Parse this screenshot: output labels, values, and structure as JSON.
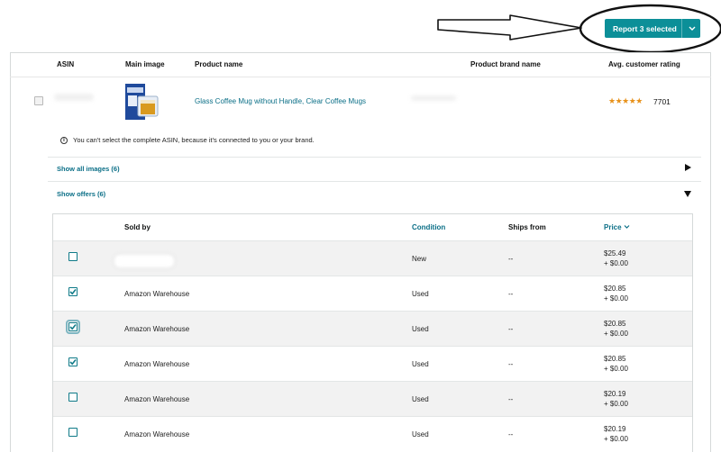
{
  "top_action": {
    "report_label": "Report 3 selected"
  },
  "columns": {
    "asin": "ASIN",
    "main_image": "Main image",
    "product_name": "Product name",
    "brand_name": "Product brand name",
    "rating": "Avg. customer rating"
  },
  "product": {
    "name": "Glass Coffee Mug without Handle, Clear Coffee Mugs",
    "stars": "★★★★★",
    "rating_count": "7701",
    "rating_value": 4.5
  },
  "info": {
    "text": "You can't select the complete ASIN, because it's connected to you or your brand.",
    "icon": "info-icon"
  },
  "sections": {
    "show_images": "Show all images (6)",
    "show_offers": "Show offers (6)"
  },
  "offers_table": {
    "headers": {
      "sold_by": "Sold by",
      "condition": "Condition",
      "ships_from": "Ships from",
      "price": "Price"
    },
    "rows": [
      {
        "seller": "",
        "condition": "New",
        "ships_from": "--",
        "price": "$25.49",
        "shipping": "+ $0.00",
        "checked": false
      },
      {
        "seller": "Amazon Warehouse",
        "condition": "Used",
        "ships_from": "--",
        "price": "$20.85",
        "shipping": "+ $0.00",
        "checked": true
      },
      {
        "seller": "Amazon Warehouse",
        "condition": "Used",
        "ships_from": "--",
        "price": "$20.85",
        "shipping": "+ $0.00",
        "checked": true
      },
      {
        "seller": "Amazon Warehouse",
        "condition": "Used",
        "ships_from": "--",
        "price": "$20.85",
        "shipping": "+ $0.00",
        "checked": true
      },
      {
        "seller": "Amazon Warehouse",
        "condition": "Used",
        "ships_from": "--",
        "price": "$20.19",
        "shipping": "+ $0.00",
        "checked": false
      },
      {
        "seller": "Amazon Warehouse",
        "condition": "Used",
        "ships_from": "--",
        "price": "$20.19",
        "shipping": "+ $0.00",
        "checked": false
      }
    ]
  },
  "colors": {
    "accent": "#0c8f98",
    "link": "#0b6f87",
    "star": "#e7911a"
  }
}
